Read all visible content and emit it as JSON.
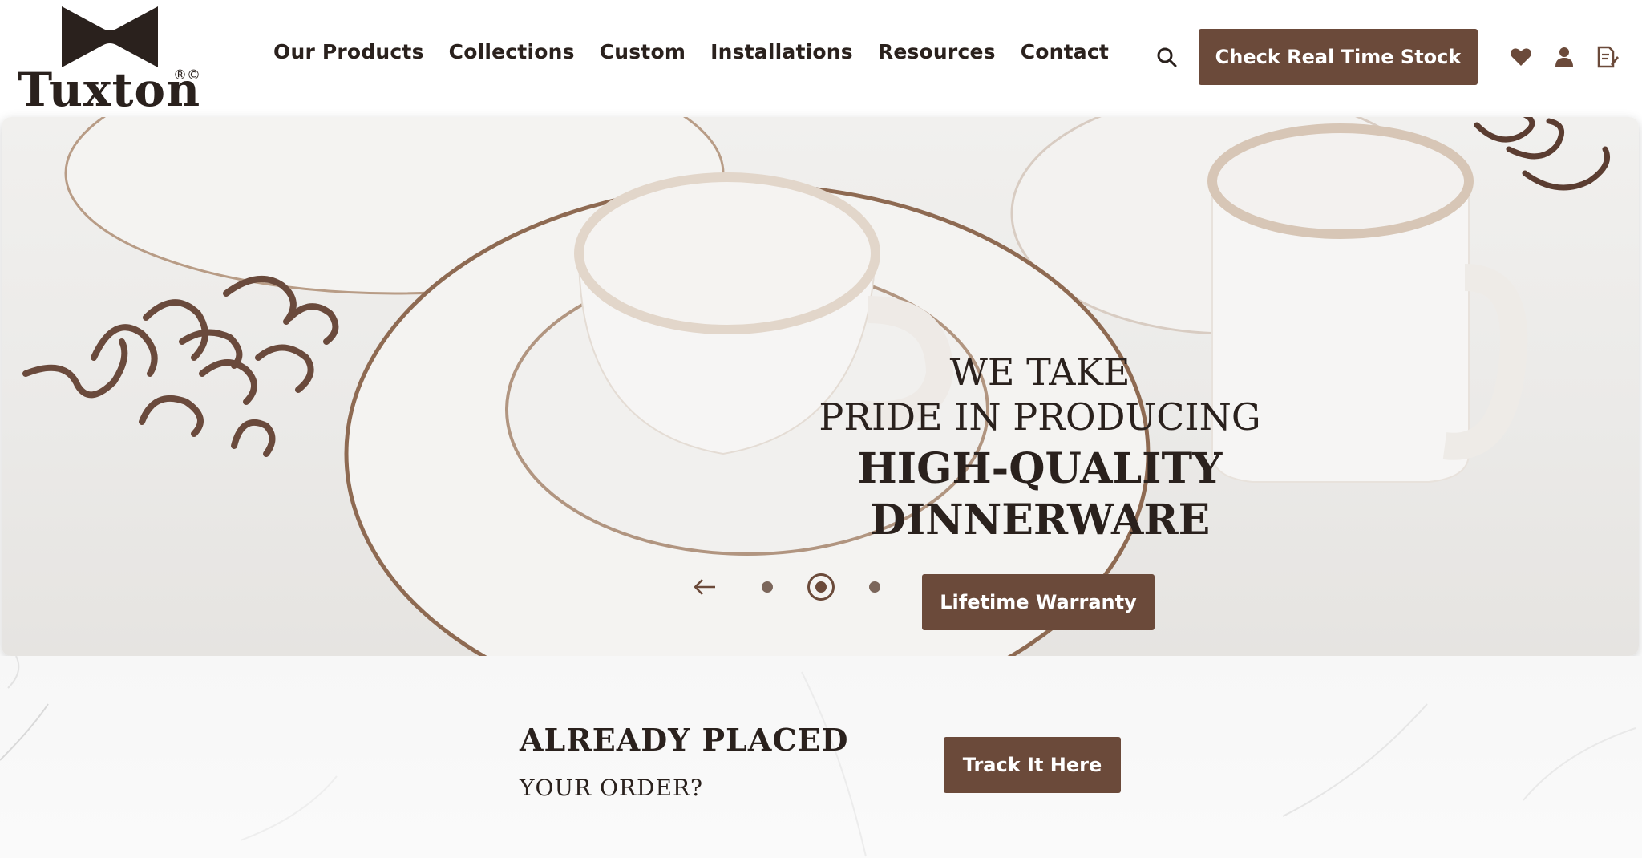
{
  "brand": {
    "name": "Tuxton",
    "marks": "®©"
  },
  "nav": {
    "items": [
      {
        "label": "Our Products"
      },
      {
        "label": "Collections"
      },
      {
        "label": "Custom"
      },
      {
        "label": "Installations"
      },
      {
        "label": "Resources"
      },
      {
        "label": "Contact"
      }
    ]
  },
  "header": {
    "stock_button": "Check Real Time Stock",
    "icons": [
      "search-icon",
      "heart-icon",
      "user-icon",
      "quote-list-icon"
    ]
  },
  "hero": {
    "line1": "WE TAKE",
    "line2": "PRIDE IN PRODUCING",
    "line3": "HIGH-QUALITY",
    "line4": "DINNERWARE",
    "button": "Lifetime Warranty",
    "slides_total": 3,
    "active_slide": 2
  },
  "order": {
    "title": "ALREADY PLACED",
    "subtitle": "YOUR ORDER?",
    "button": "Track It Here"
  },
  "colors": {
    "accent": "#6b4a3a",
    "text": "#2a211d",
    "background": "#ffffff"
  }
}
